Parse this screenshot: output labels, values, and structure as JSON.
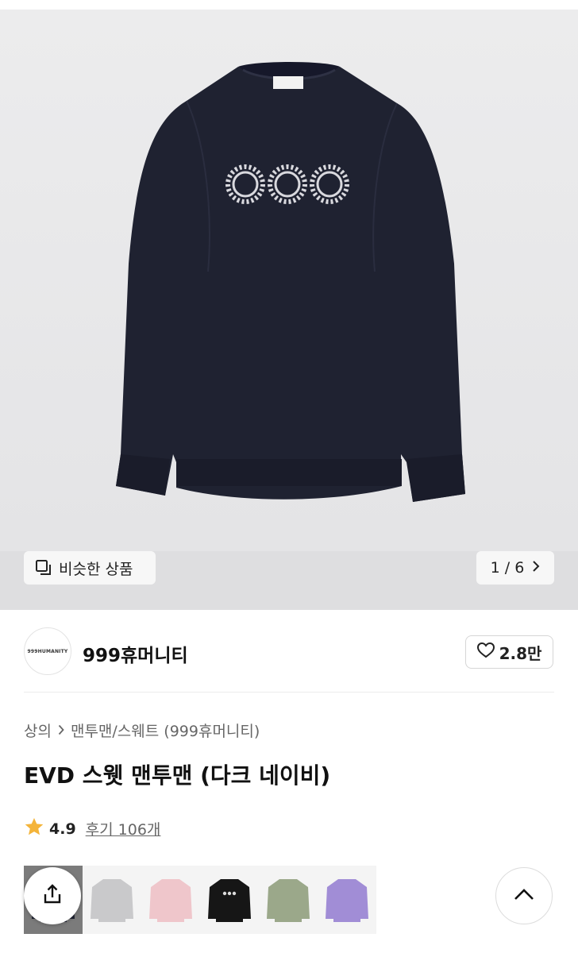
{
  "gallery": {
    "similar_label": "비슷한 상품",
    "counter": "1 / 6",
    "main_color": "#1f2231"
  },
  "brand": {
    "logo_text": "999HUMANITY",
    "name": "999휴머니티",
    "likes": "2.8만"
  },
  "breadcrumb": {
    "category": "상의",
    "subcategory": "맨투맨/스웨트 (999휴머니티)"
  },
  "product": {
    "title": "EVD 스웻 맨투맨 (다크 네이비)",
    "rating": "4.9",
    "reviews": "후기 106개"
  },
  "swatches": [
    {
      "name": "dark navy",
      "color": "#1f2231"
    },
    {
      "name": "gray",
      "color": "#c9c9cb"
    },
    {
      "name": "pink",
      "color": "#efc6cb"
    },
    {
      "name": "black",
      "color": "#161616"
    },
    {
      "name": "khaki",
      "color": "#9ba88a"
    },
    {
      "name": "lavender",
      "color": "#a18dd6"
    }
  ],
  "colors": {
    "star": "#f4b43a",
    "accent": "#111111"
  }
}
